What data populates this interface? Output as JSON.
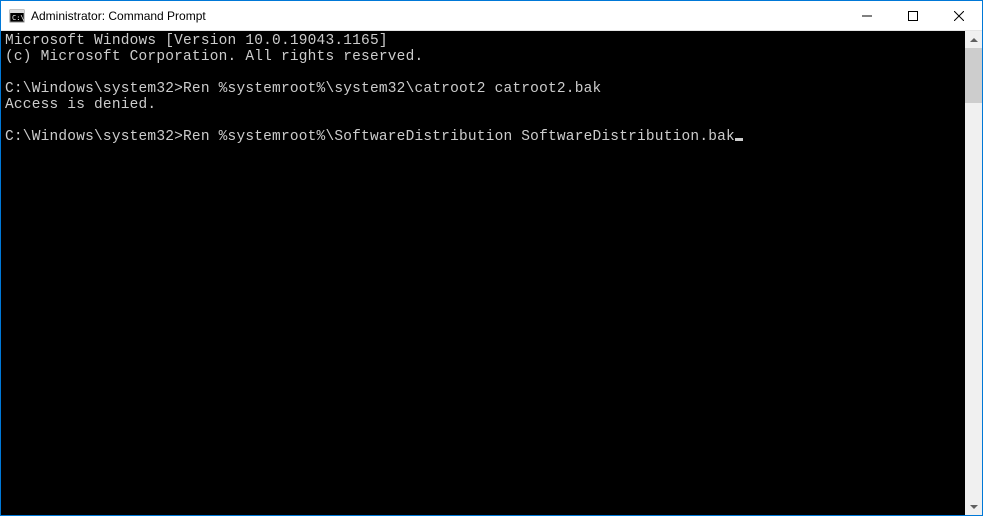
{
  "titlebar": {
    "title": "Administrator: Command Prompt"
  },
  "terminal": {
    "line1": "Microsoft Windows [Version 10.0.19043.1165]",
    "line2": "(c) Microsoft Corporation. All rights reserved.",
    "blank1": "",
    "prompt1_path": "C:\\Windows\\system32>",
    "prompt1_cmd": "Ren %systemroot%\\system32\\catroot2 catroot2.bak",
    "result1": "Access is denied.",
    "blank2": "",
    "prompt2_path": "C:\\Windows\\system32>",
    "prompt2_cmd": "Ren %systemroot%\\SoftwareDistribution SoftwareDistribution.bak"
  }
}
